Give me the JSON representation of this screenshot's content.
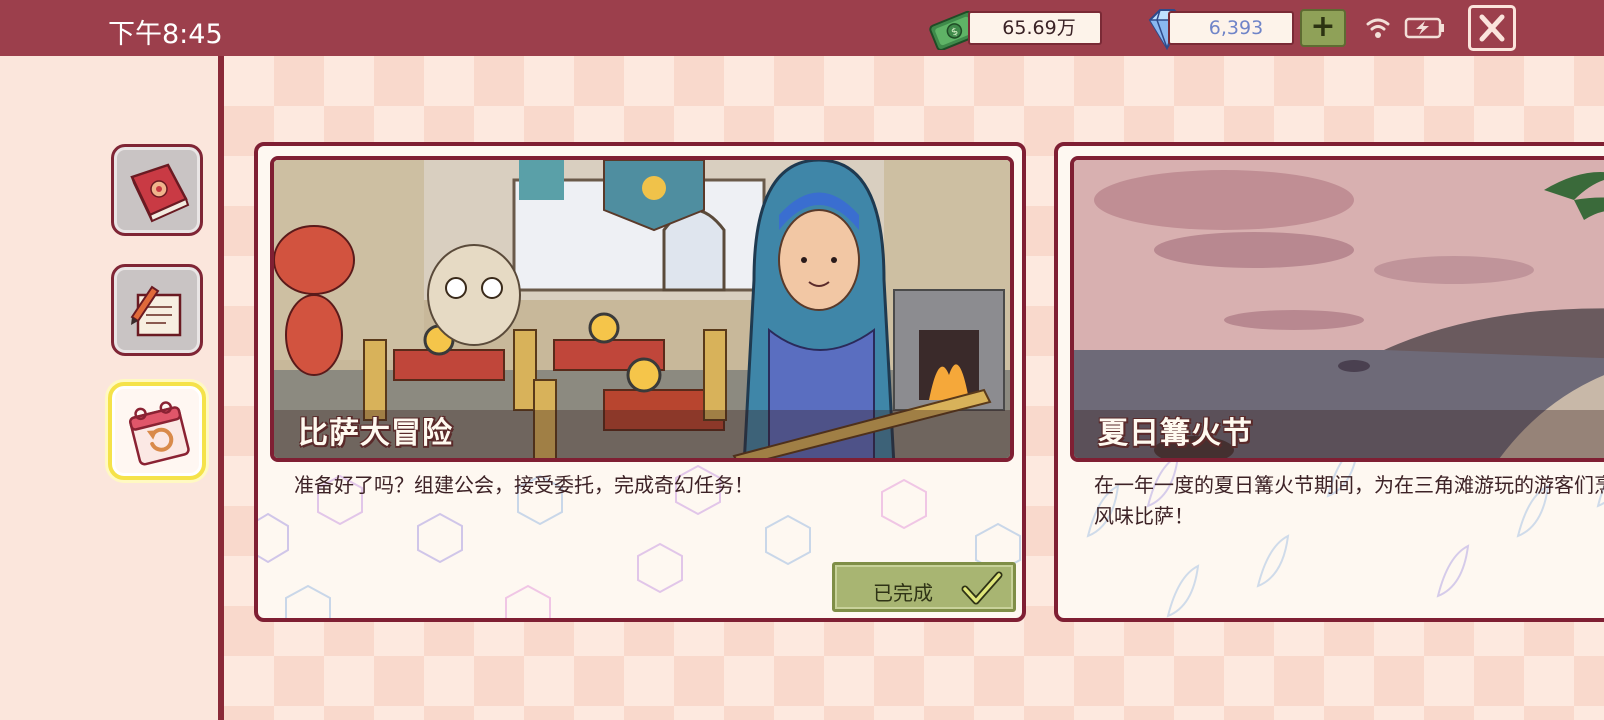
{
  "status_bar": {
    "time": "下午8:45"
  },
  "currency": {
    "money": "65.69万",
    "gems": "6,393",
    "add_label": "+"
  },
  "sidebar": {
    "items": [
      {
        "icon": "book-icon",
        "selected": false
      },
      {
        "icon": "scroll-quill-icon",
        "selected": false
      },
      {
        "icon": "calendar-replay-icon",
        "selected": true
      }
    ]
  },
  "cards": [
    {
      "title": "比萨大冒险",
      "description": "准备好了吗？组建公会，接受委托，完成奇幻任务！",
      "status": "已完成"
    },
    {
      "title": "夏日篝火节",
      "description_line1": "在一年一度的夏日篝火节期间，为在三角滩游玩的游客们烹饪海洋",
      "description_line2": "风味比萨！"
    }
  ],
  "colors": {
    "topbar": "#9c3f4c",
    "border": "#7f1f33",
    "completed_green": "#a8b572",
    "highlight_yellow": "#f5e24a"
  }
}
